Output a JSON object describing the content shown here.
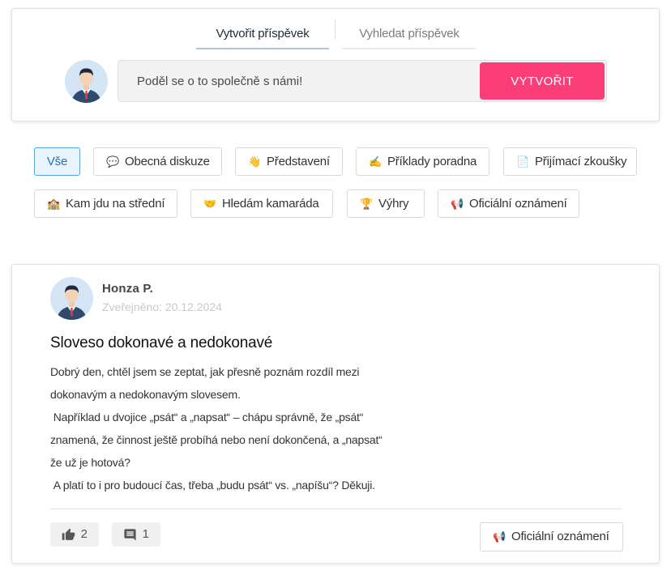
{
  "tabs": [
    {
      "label": "Vytvořit příspěvek",
      "active": true
    },
    {
      "label": "Vyhledat příspěvek",
      "active": false
    }
  ],
  "composer": {
    "placeholder": "Poděl se o to společně s námi!",
    "button_label": "VYTVOŘIT"
  },
  "filters": [
    {
      "label": "Vše",
      "icon": "",
      "active": true
    },
    {
      "label": "Obecná diskuze",
      "icon": "💬"
    },
    {
      "label": "Představení",
      "icon": "👋"
    },
    {
      "label": "Příklady poradna",
      "icon": "✍"
    },
    {
      "label": "Přijímací zkoušky",
      "icon": "📄"
    },
    {
      "label": "Kam jdu na střední",
      "icon": "🏫"
    },
    {
      "label": "Hledám kamaráda",
      "icon": "🤝"
    },
    {
      "label": "Výhry",
      "icon": "🏆"
    },
    {
      "label": "Oficiální oznámení",
      "icon": "📢"
    }
  ],
  "post": {
    "author": "Honza P.",
    "date": "Zveřejněno: 20.12.2024",
    "title": "Sloveso dokonavé a nedokonavé",
    "body_lines": [
      "Dobrý den, chtěl jsem se zeptat, jak přesně poznám rozdíl mezi",
      "dokonavým a nedokonavým slovesem.",
      " Například u dvojice „psát“ a „napsat“ – chápu správně, že „psát“",
      "znamená, že činnost ještě probíhá nebo není dokončená, a „napsat“",
      "že už je hotová?",
      " A platí to i pro budoucí čas, třeba „budu psát“ vs. „napíšu“? Děkuji."
    ],
    "likes": "2",
    "comments": "1",
    "category": {
      "label": "Oficiální oznámení",
      "icon": "📢"
    }
  },
  "colors": {
    "accent": "#fb3d78",
    "active_chip_border": "#58a3db",
    "active_chip_bg": "#eaf4fc"
  }
}
